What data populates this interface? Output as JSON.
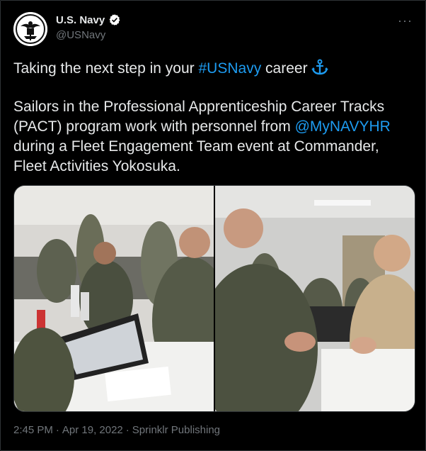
{
  "account": {
    "display_name": "U.S. Navy",
    "handle": "@USNavy",
    "verified_icon": "verified-badge-icon",
    "avatar_icon": "us-navy-seal-icon"
  },
  "more_label": "···",
  "tweet": {
    "line1_pre": "Taking the next step in your ",
    "line1_hashtag": "#USNavy",
    "line1_post": " career",
    "anchor_icon": "anchor-icon",
    "para2_pre": "Sailors in the Professional Apprenticeship Career Tracks (PACT) program work with personnel from ",
    "para2_mention": "@MyNAVYHR",
    "para2_post": " during a Fleet Engagement Team event at Commander, Fleet Activities Yokosuka."
  },
  "meta": {
    "time": "2:45 PM",
    "sep1": "·",
    "date": "Apr 19, 2022",
    "sep2": "·",
    "source": "Sprinklr Publishing"
  },
  "colors": {
    "background": "#000000",
    "text": "#e7e9ea",
    "secondary": "#71767b",
    "link": "#1d9bf0",
    "border": "#2f3336"
  }
}
